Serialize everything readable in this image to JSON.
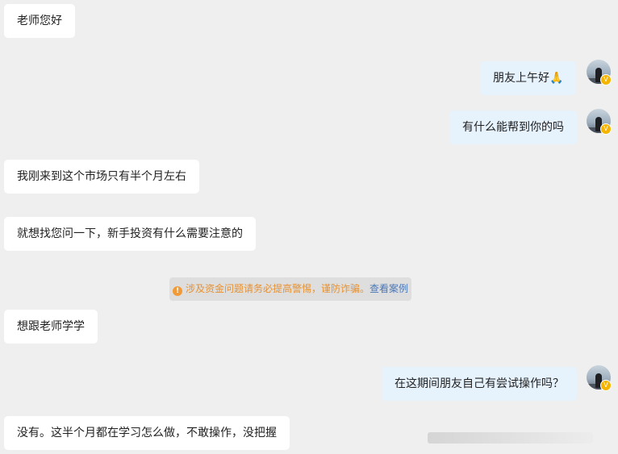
{
  "messages": [
    {
      "side": "left",
      "text": "老师您好"
    },
    {
      "side": "right",
      "text": "朋友上午好🙏"
    },
    {
      "side": "right",
      "text": "有什么能帮到你的吗"
    },
    {
      "side": "left",
      "text": "我刚来到这个市场只有半个月左右"
    },
    {
      "side": "left",
      "text": "就想找您问一下，新手投资有什么需要注意的"
    },
    {
      "side": "left",
      "text": "想跟老师学学"
    },
    {
      "side": "right",
      "text": "在这期间朋友自己有尝试操作吗？"
    },
    {
      "side": "left",
      "text": "没有。这半个月都在学习怎么做，不敢操作，没把握"
    }
  ],
  "notice": {
    "icon": "info-icon",
    "warning_text": "涉及资金问题请务必提高警惕，谨防诈骗。",
    "link_text": "查看案例"
  },
  "avatar": {
    "badge": "V"
  },
  "colors": {
    "background": "#efefef",
    "left_bubble": "#ffffff",
    "right_bubble": "#e6f2fc",
    "notice_text": "#e8902f",
    "notice_link": "#4a78b8",
    "badge": "#f4b400"
  }
}
